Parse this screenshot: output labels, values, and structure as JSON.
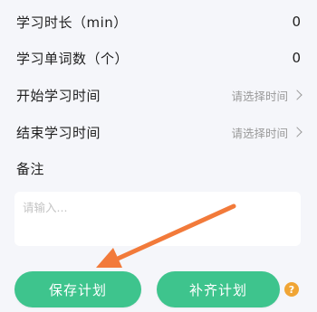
{
  "form": {
    "duration": {
      "label": "学习时长（min）",
      "value": "0"
    },
    "words": {
      "label": "学习单词数（个）",
      "value": "0"
    },
    "start_time": {
      "label": "开始学习时间",
      "placeholder": "请选择时间"
    },
    "end_time": {
      "label": "结束学习时间",
      "placeholder": "请选择时间"
    },
    "notes": {
      "label": "备注",
      "placeholder": "请输入..."
    }
  },
  "actions": {
    "save_label": "保存计划",
    "supplement_label": "补齐计划",
    "help_symbol": "?"
  },
  "colors": {
    "accent": "#3ec48d",
    "annotation_arrow": "#f27a3a",
    "help_badge": "#f0a535"
  }
}
